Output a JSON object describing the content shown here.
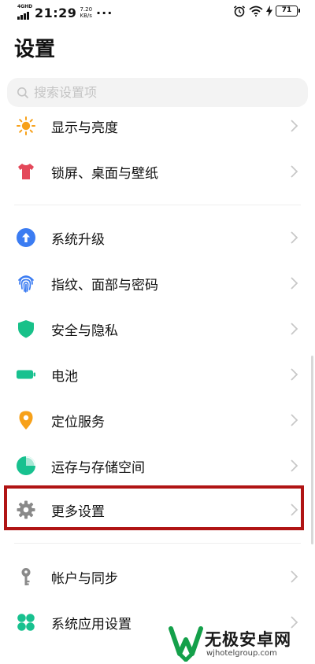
{
  "status_bar": {
    "network_tag": "4GHD",
    "time": "21:29",
    "speed_value": "7.20",
    "speed_unit": "KB/s",
    "more_dots": "···",
    "battery_level": "71",
    "icons": [
      "alarm-icon",
      "wifi-icon",
      "charging-icon",
      "battery-icon"
    ]
  },
  "page": {
    "title": "设置"
  },
  "search": {
    "placeholder": "搜索设置项"
  },
  "settings": [
    {
      "label": "显示与亮度",
      "icon": "sun-icon",
      "color": "#f7a11a"
    },
    {
      "label": "锁屏、桌面与壁纸",
      "icon": "tshirt-icon",
      "color": "#e4485a"
    },
    {
      "label": "系统升级",
      "icon": "upgrade-icon",
      "color": "#3b7cf2"
    },
    {
      "label": "指纹、面部与密码",
      "icon": "fingerprint-icon",
      "color": "#3b7cf2"
    },
    {
      "label": "安全与隐私",
      "icon": "shield-icon",
      "color": "#18c189"
    },
    {
      "label": "电池",
      "icon": "battery-setting-icon",
      "color": "#18c18f"
    },
    {
      "label": "定位服务",
      "icon": "location-pin-icon",
      "color": "#f7a11a"
    },
    {
      "label": "运存与存储空间",
      "icon": "storage-pie-icon",
      "color": "#18c18f"
    },
    {
      "label": "更多设置",
      "icon": "gear-icon",
      "color": "#8a8a8a"
    },
    {
      "label": "帐户与同步",
      "icon": "key-icon",
      "color": "#8a8a8a"
    },
    {
      "label": "系统应用设置",
      "icon": "apps-grid-icon",
      "color": "#18c18f"
    }
  ],
  "watermark": {
    "title": "无极安卓网",
    "url": "wjhotelgroup.com"
  }
}
